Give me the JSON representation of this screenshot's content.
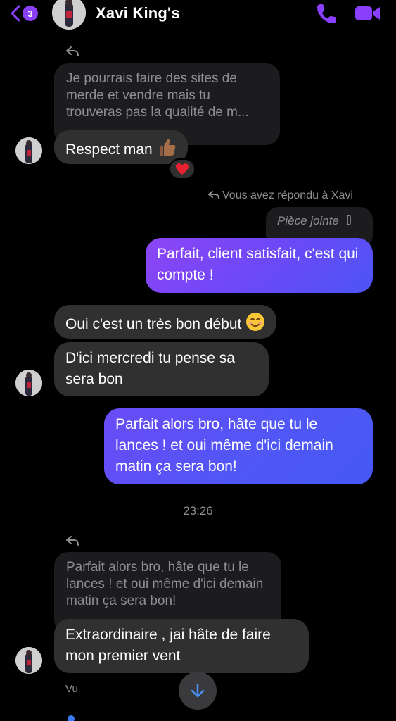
{
  "header": {
    "back_badge": "3",
    "contact_name": "Xavi King's",
    "accent_color": "#8a3ffc",
    "icons": [
      "chevron-left-icon",
      "phone-icon",
      "video-camera-icon"
    ]
  },
  "messages": {
    "quoted_1": "Je pourrais faire des sites de merde et vendre mais tu trouveras pas la qualité de m...",
    "in_1": "Respect man",
    "in_1_emoji": "thumbs-up-icon",
    "reaction_1": "heart-icon",
    "reply_note": "Vous avez répondu à Xavi",
    "attachment_label": "Pièce jointe",
    "out_1": "Parfait, client satisfait, c'est qui compte !",
    "in_2": "Oui c'est un très bon début",
    "in_2_emoji": "smiling-face-icon",
    "in_3": "D'ici mercredi tu pense sa sera bon",
    "out_2": "Parfait alors bro, hâte que tu le lances ! et oui même d'ici demain matin ça sera bon!",
    "time": "23:26",
    "quoted_2": "Parfait alors bro, hâte que tu le lances ! et oui même d'ici demain matin ça sera bon!",
    "in_4": "Extraordinaire , jai  hâte de faire mon premier  vent",
    "seen": "Vu"
  },
  "colors": {
    "outgoing_start": "#8d45f5",
    "outgoing_end": "#4d55f6",
    "incoming": "#303030",
    "quoted": "#1c1c1e"
  }
}
